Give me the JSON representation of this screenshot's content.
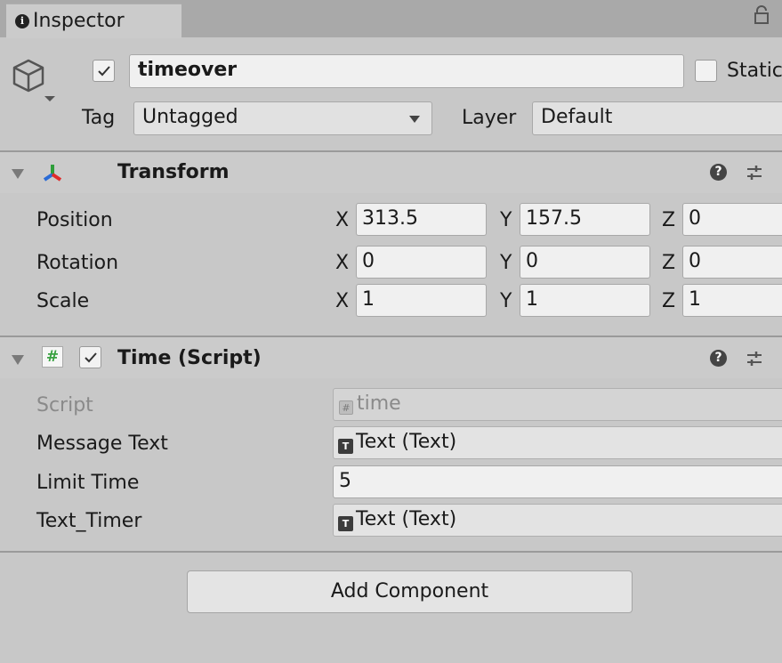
{
  "window": {
    "tab_title": "Inspector",
    "info_glyph": "i",
    "lock_glyph": "⌂"
  },
  "gameobject": {
    "active": true,
    "name": "timeover",
    "static_label": "Static",
    "tag_label": "Tag",
    "tag_value": "Untagged",
    "layer_label": "Layer",
    "layer_value": "Default"
  },
  "transform": {
    "title": "Transform",
    "rows": [
      {
        "label": "Position",
        "x": "313.5",
        "y": "157.5",
        "z": "0"
      },
      {
        "label": "Rotation",
        "x": "0",
        "y": "0",
        "z": "0"
      },
      {
        "label": "Scale",
        "x": "1",
        "y": "1",
        "z": "1"
      }
    ],
    "axis_labels": {
      "x": "X",
      "y": "Y",
      "z": "Z"
    }
  },
  "script_component": {
    "title": "Time (Script)",
    "enabled": true,
    "script_icon_glyph": "#",
    "fields": [
      {
        "label": "Script",
        "value": "time",
        "kind": "script-ref",
        "disabled": true
      },
      {
        "label": "Message Text",
        "value": "Text (Text)",
        "kind": "object-ref"
      },
      {
        "label": "Limit Time",
        "value": "5",
        "kind": "number"
      },
      {
        "label": "Text_Timer",
        "value": "Text (Text)",
        "kind": "object-ref"
      }
    ]
  },
  "add_component_label": "Add Component",
  "icons": {
    "gameobject": "cube-icon",
    "transform": "transform-axes-icon",
    "script": "script-hash-icon",
    "help": "help-icon",
    "settings": "preset-sliders-icon",
    "text_ref": "text-component-icon"
  },
  "colors": {
    "background": "#c8c8c8",
    "tabbar": "#a9a9a9",
    "axis_x": "#e02b2b",
    "axis_y": "#2e9e3a",
    "axis_z": "#2a6bd6",
    "script_icon": "#3aa142"
  }
}
